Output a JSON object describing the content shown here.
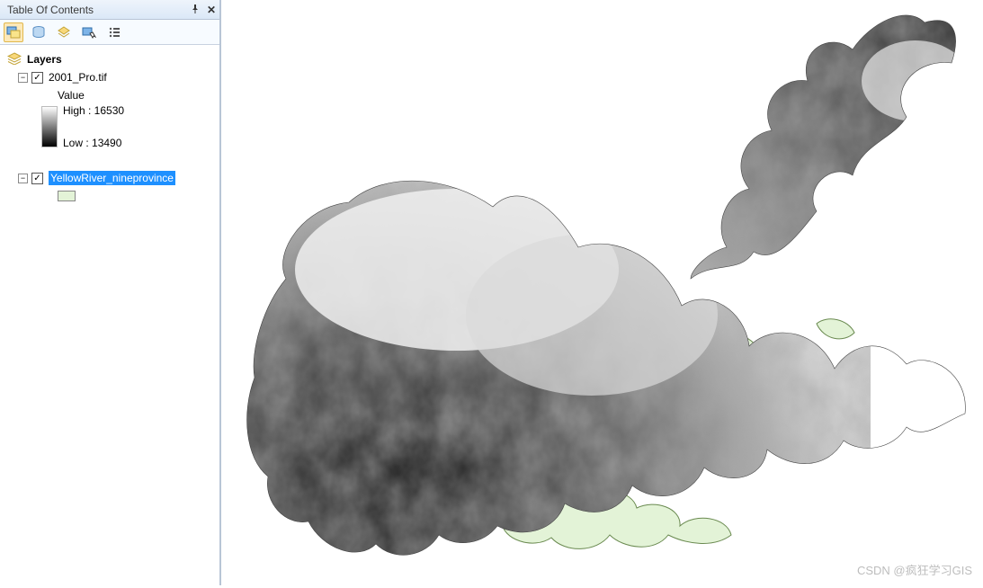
{
  "toc": {
    "title": "Table Of Contents",
    "root_label": "Layers",
    "layers": [
      {
        "name": "2001_Pro.tif",
        "type": "raster",
        "value_label": "Value",
        "high_label": "High : 16530",
        "low_label": "Low : 13490",
        "checked": true,
        "selected": false
      },
      {
        "name": "YellowRiver_nineprovince",
        "type": "vector",
        "swatch_color": "#e3f3d7",
        "checked": true,
        "selected": true
      }
    ]
  },
  "icons": {
    "pin": "📌",
    "close": "✕",
    "check": "✓",
    "minus": "−"
  },
  "toolbar": {
    "buttons": [
      {
        "name": "list-by-drawing-order-icon",
        "active": true
      },
      {
        "name": "list-by-source-icon",
        "active": false
      },
      {
        "name": "list-by-visibility-icon",
        "active": false
      },
      {
        "name": "list-by-selection-icon",
        "active": false
      },
      {
        "name": "options-icon",
        "active": false
      }
    ]
  },
  "watermark": "CSDN @疯狂学习GIS"
}
